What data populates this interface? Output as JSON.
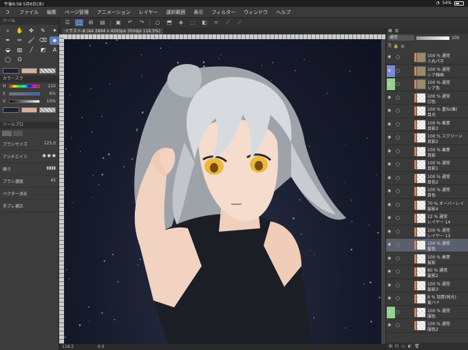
{
  "status": {
    "time": "午後6:58",
    "date": "5月6日(水)",
    "battery": "54%",
    "battery_level": 0.54
  },
  "menu": [
    "ファイル",
    "編集",
    "ページ管理",
    "アニメーション",
    "レイヤー",
    "選択範囲",
    "表示",
    "フィルター",
    "ウィンドウ",
    "ヘルプ"
  ],
  "icons": {
    "app": "clip-studio-logo-icon"
  },
  "document_tab": "イラスト-8 (A4 2894 x 4093px 350dpi 118.5%)",
  "left_panel": {
    "tool_header": "ツール",
    "color_header": "カラースラ",
    "hsv": [
      {
        "label": "H",
        "value": "210"
      },
      {
        "label": "S",
        "value": "6%"
      },
      {
        "label": "V",
        "value": "10%"
      }
    ],
    "prop_header": "ツールプロ",
    "brush_size_label": "ブラシサイズ",
    "brush_size_value": "125.0",
    "antialias_label": "アンチエイリ",
    "hardness_label": "硬さ",
    "density_label": "ブラシ濃度",
    "density_value": "45",
    "vector_label": "ベクター消去",
    "stabilize_label": "手ブレ補正"
  },
  "bottom": {
    "zoom": "118.5",
    "rotate": "0.0"
  },
  "right_panel": {
    "blend_mode": "通常",
    "opacity": "100"
  },
  "layers": [
    {
      "l1": "100 % 通常",
      "l2": "人丸パネ",
      "kind": "folder"
    },
    {
      "l1": "100 % 通常",
      "l2": "シア線画",
      "kind": "folder",
      "mark": "blue"
    },
    {
      "l1": "100 % 通常",
      "l2": "シア色",
      "kind": "folder",
      "mark": "green"
    },
    {
      "l1": "100 % 通常",
      "l2": "口色"
    },
    {
      "l1": "100 % 重ね(乗)",
      "l2": "目光"
    },
    {
      "l1": "100 % 乗算",
      "l2": "目影3"
    },
    {
      "l1": "100 % スクリーン",
      "l2": "目影2"
    },
    {
      "l1": "100 % 乗算",
      "l2": "目影"
    },
    {
      "l1": "100 % 通常",
      "l2": "目影1"
    },
    {
      "l1": "100 % 通常",
      "l2": "目色2"
    },
    {
      "l1": "100 % 通常",
      "l2": "目色"
    },
    {
      "l1": "70 % オーバーレイ",
      "l2": "髪影4"
    },
    {
      "l1": "22 % 通常",
      "l2": "レイヤー 14"
    },
    {
      "l1": "100 % 通常",
      "l2": "レイヤー 13"
    },
    {
      "l1": "100 % 通常",
      "l2": "髪色",
      "selected": true
    },
    {
      "l1": "100 % 乗算",
      "l2": "髪影"
    },
    {
      "l1": "80 % 通常",
      "l2": "髪影2"
    },
    {
      "l1": "100 % 通常",
      "l2": "髪影3"
    },
    {
      "l1": "8 % 加算(発光)",
      "l2": "髪ハイ"
    },
    {
      "l1": "100 % 通常",
      "l2": "服色",
      "mark": "green"
    },
    {
      "l1": "100 % 通常",
      "l2": "服色2"
    }
  ],
  "colors": {
    "accent": "#5b7bb4",
    "selected_layer": "#5a5f6e",
    "main_color": "#1b2233",
    "sub_color": "#d8b09a"
  }
}
